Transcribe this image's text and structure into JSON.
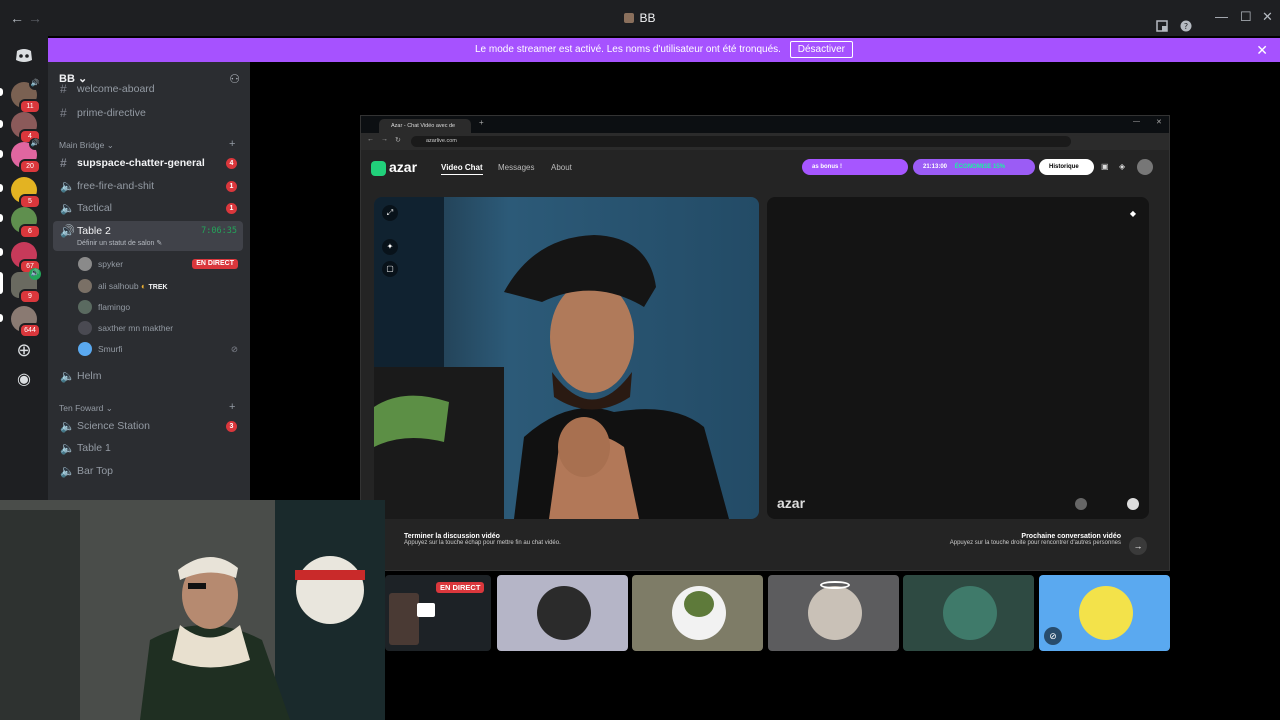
{
  "titlebar": {
    "back_label": "←",
    "forward_label": "→",
    "title": "BB",
    "minimize_label": "—",
    "maximize_label": "☐",
    "close_label": "✕"
  },
  "banner": {
    "text": "Le mode streamer est activé. Les noms d'utilisateur ont été tronqués.",
    "button_label": "Désactiver"
  },
  "servers": {
    "badges": [
      "11",
      "4",
      "20",
      "5",
      "6",
      "67",
      "9",
      "644"
    ]
  },
  "sidebar": {
    "guild_name": "BB",
    "cut_channel": "welcome-aboard",
    "channel_prime": "prime-directive",
    "category1": "Main Bridge",
    "category2": "Ten Foward",
    "channels": [
      {
        "name": "supspace-chatter-general",
        "badge": "4"
      },
      {
        "name": "free-fire-and-shit",
        "badge": "1"
      },
      {
        "name": "Tactical",
        "badge": "1"
      }
    ],
    "active_channel": {
      "name": "Table 2",
      "status": "Définir un statut de salon",
      "timer": "7:06:35"
    },
    "users": [
      {
        "name": "spyker",
        "live": "EN DIRECT"
      },
      {
        "name": "ali salhoub",
        "tag": "TREK"
      },
      {
        "name": "flamingo"
      },
      {
        "name": "saxther mn makther"
      },
      {
        "name": "Smurfi"
      }
    ],
    "helm": "Helm",
    "channels2": [
      {
        "name": "Science Station",
        "badge": "3"
      },
      {
        "name": "Table 1"
      },
      {
        "name": "Bar Top"
      }
    ]
  },
  "browser": {
    "tab_title": "Azar - Chat Vidéo avec de",
    "url": "azarlive.com"
  },
  "azar": {
    "logo": "azar",
    "nav": [
      "Video Chat",
      "Messages",
      "About"
    ],
    "bonus_pill": "as bonus !",
    "timer_pill": "21:13:00",
    "economy_pill": "ÉCONOMISE 15%",
    "history_label": "Historique",
    "watermark": "azar",
    "end_title": "Terminer la discussion vidéo",
    "end_sub": "Appuyez sur la touche échap pour mettre fin au chat vidéo.",
    "next_title": "Prochaine conversation vidéo",
    "next_sub": "Appuyez sur la touche droite pour rencontrer d'autres personnes"
  },
  "participants": {
    "live_label": "EN DIRECT"
  },
  "colors": {
    "streamer_banner": "#a652ff",
    "unread_badge": "#da373c",
    "voice_green": "#23a55a",
    "azar_accent": "#21d07a",
    "thumb_blue": "#5aa9f0"
  }
}
